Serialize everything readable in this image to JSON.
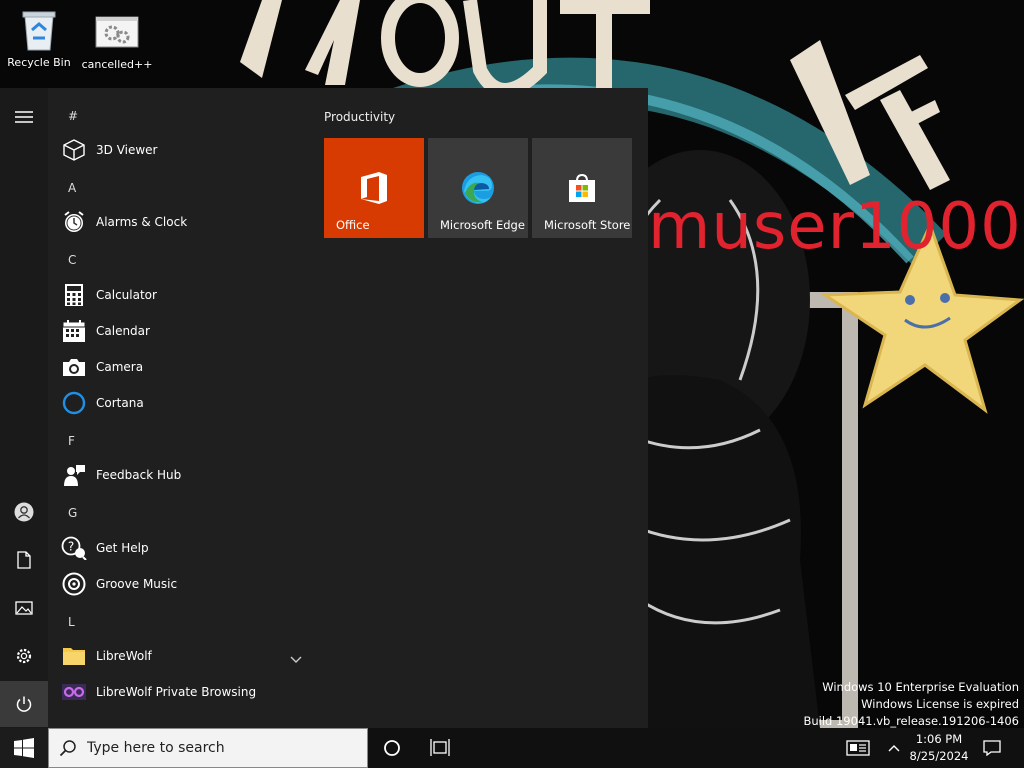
{
  "desktop": {
    "icons": [
      {
        "label": "Recycle Bin"
      },
      {
        "label": "cancelled++"
      }
    ],
    "wallpaper_text": "muser1000"
  },
  "start_menu": {
    "groups": {
      "hash": "#",
      "a": "A",
      "c": "C",
      "f": "F",
      "g": "G",
      "l": "L"
    },
    "apps": {
      "viewer": "3D Viewer",
      "alarms": "Alarms & Clock",
      "calculator": "Calculator",
      "calendar": "Calendar",
      "camera": "Camera",
      "cortana": "Cortana",
      "feedback": "Feedback Hub",
      "gethelp": "Get Help",
      "groove": "Groove Music",
      "librewolf": "LibreWolf",
      "librewolf_private": "LibreWolf Private Browsing"
    },
    "tiles": {
      "section_title": "Productivity",
      "office": "Office",
      "edge": "Microsoft Edge",
      "store": "Microsoft Store"
    }
  },
  "watermark": {
    "line1": "Windows 10 Enterprise Evaluation",
    "line2": "Windows License is expired",
    "line3": "Build 19041.vb_release.191206-1406"
  },
  "taskbar": {
    "search_placeholder": "Type here to search",
    "time": "1:06 PM",
    "date": "8/25/2024"
  },
  "colors": {
    "office_tile": "#d83b01",
    "tile_gray": "#3a3a3a",
    "menu_bg": "#1f1f1f",
    "wallpaper_red": "#e0232e"
  }
}
